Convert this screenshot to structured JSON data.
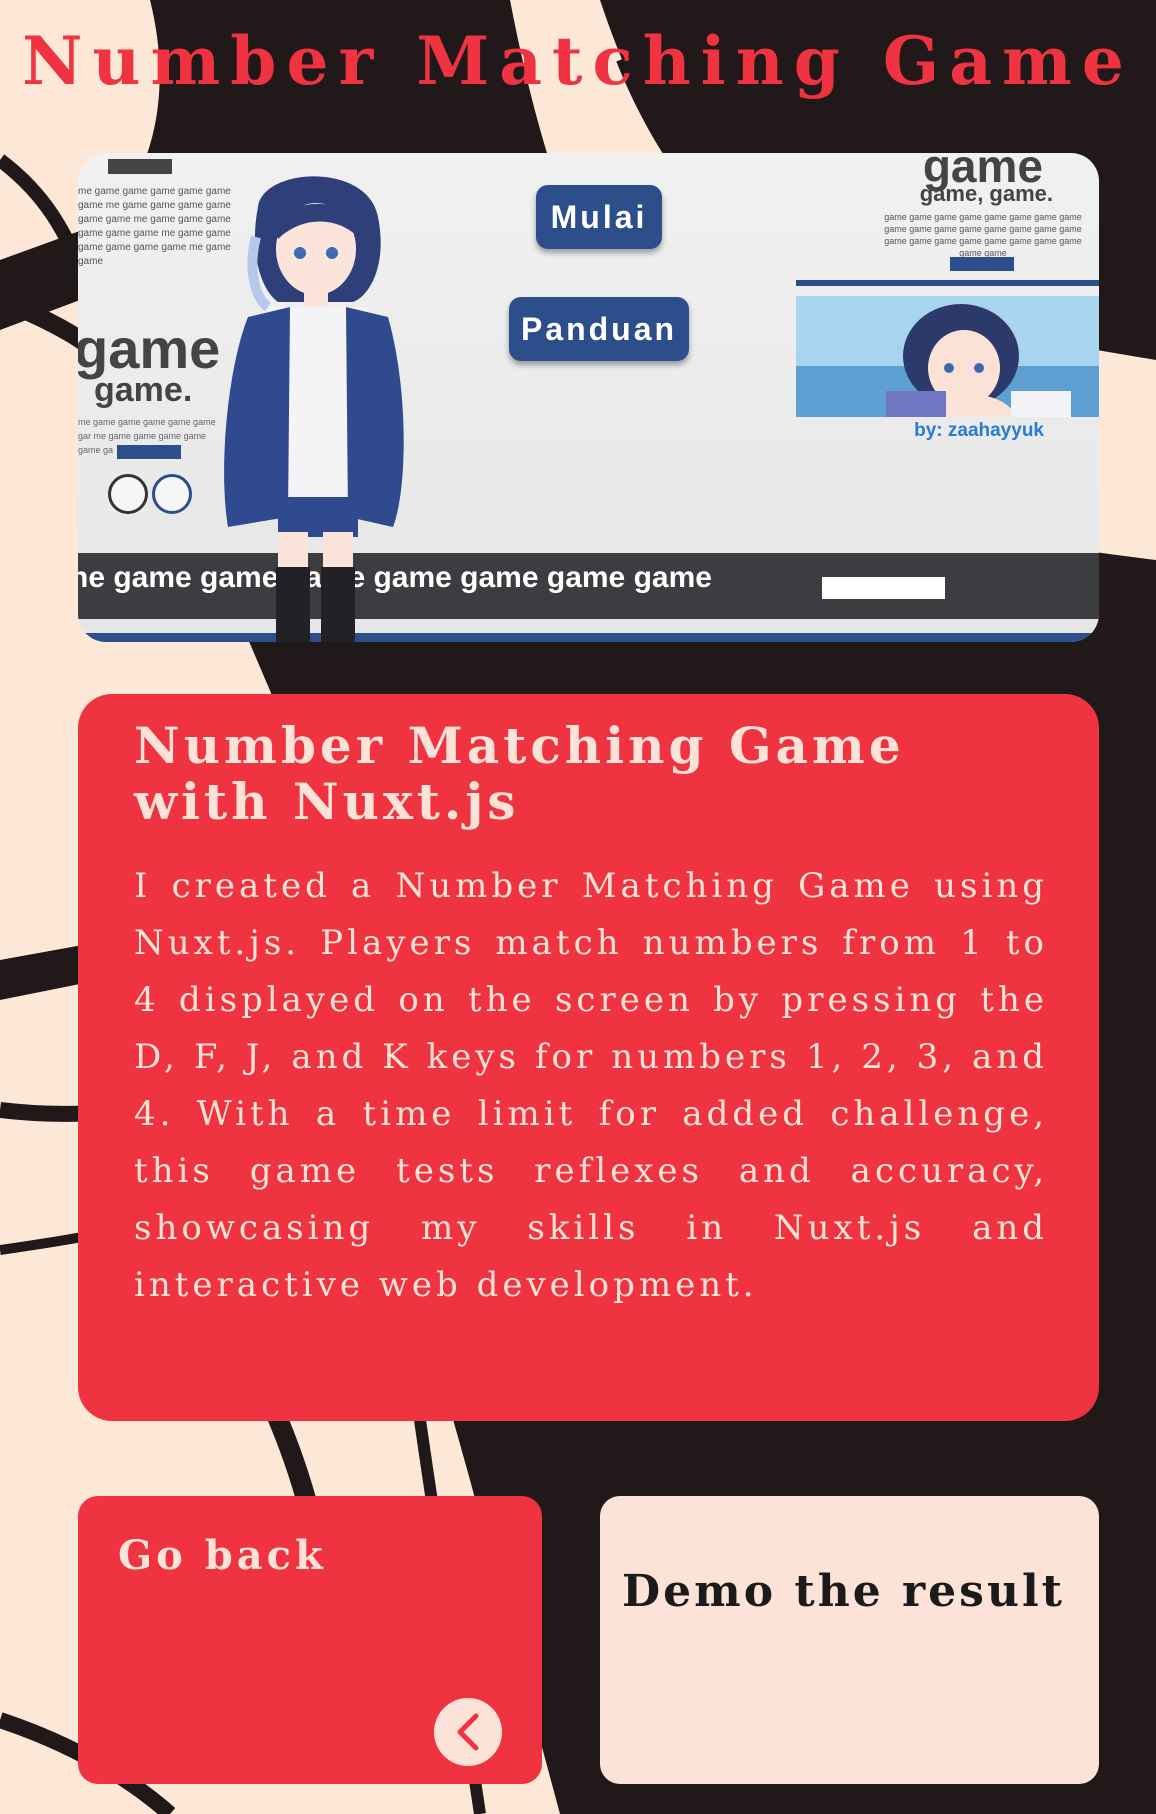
{
  "page": {
    "title": "Number Matching Game"
  },
  "preview": {
    "filler_left": "me game game game game game game me game game game game game game me game game game game game game me game game game game game game me game game",
    "big_game_left": "game",
    "game_dot_left": "game.",
    "filler_left2": "me game game game game game gar me game game game game game ga",
    "mulai_label": "Mulai",
    "panduan_label": "Panduan",
    "big_game_right": "game",
    "game_game_right": "game, game.",
    "filler_right": "game game game game game game game game game game game game game game game game game game game game game game game game game game",
    "credit": "by: zaahayyuk",
    "ticker": "ne game game game game game game game"
  },
  "description": {
    "title": "Number Matching Game with Nuxt.js",
    "body": "I created a Number Matching Game using Nuxt.js. Players match numbers from 1 to 4 displayed on the screen by pressing the D, F, J, and K keys for numbers 1, 2, 3, and 4. With a time limit for added challenge, this game tests reflexes and accuracy, showcasing my skills in Nuxt.js and interactive web development."
  },
  "actions": {
    "back_label": "Go back",
    "back_icon": "chevron-left-icon",
    "demo_label": "Demo the result"
  },
  "colors": {
    "accent_red": "#ef3340",
    "cream": "#fde3d7",
    "dark_bg": "#201819",
    "preview_blue": "#2c4f8c"
  }
}
